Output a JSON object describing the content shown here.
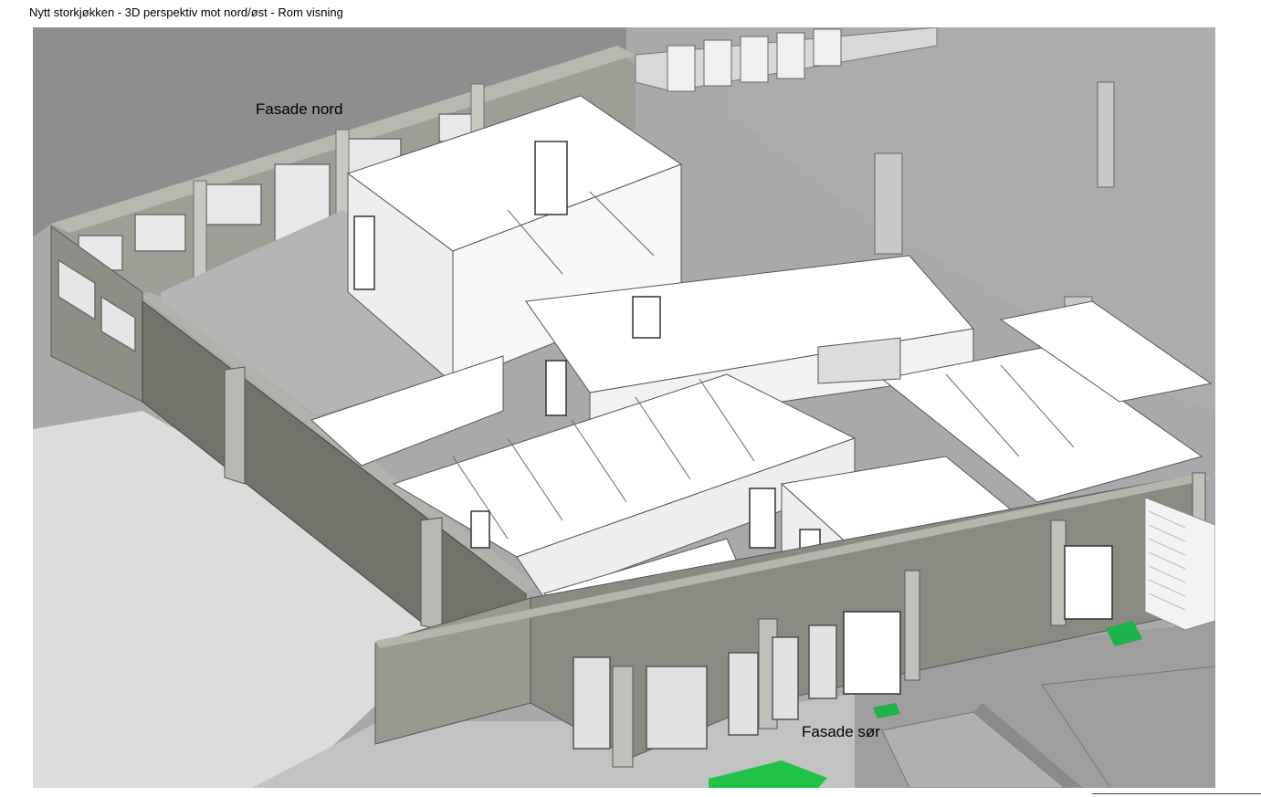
{
  "page": {
    "title": "Nytt storkjøkken - 3D perspektiv mot nord/øst - Rom visning"
  },
  "labels": {
    "north": "Fasade nord",
    "south": "Fasade sør"
  },
  "colors": {
    "ground_dark": "#8c8c8c",
    "ground_mid": "#a9a9a9",
    "ground_light": "#d2d2d2",
    "wall_exterior": "#8e8d85",
    "wall_exterior_dark": "#727169",
    "wall_interior": "#ffffff",
    "wall_shade": "#e6e6e6",
    "window_frame": "#9a9a9a",
    "exit_sign": "#1fb14a",
    "grass": "#22c24a"
  }
}
